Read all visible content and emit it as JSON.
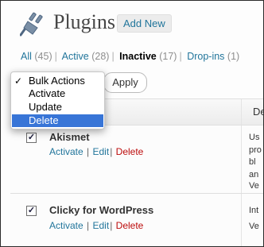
{
  "header": {
    "title": "Plugins",
    "add_new_label": "Add New",
    "icon": "plugin-plug-icon"
  },
  "filters": [
    {
      "label": "All",
      "count": "(45)",
      "current": false
    },
    {
      "label": "Active",
      "count": "(28)",
      "current": false
    },
    {
      "label": "Inactive",
      "count": "(17)",
      "current": true
    },
    {
      "label": "Drop-ins",
      "count": "(1)",
      "current": false
    }
  ],
  "bulk_actions": {
    "options": [
      "Bulk Actions",
      "Activate",
      "Update",
      "Delete"
    ],
    "checked_option": "Bulk Actions",
    "highlighted_option": "Delete"
  },
  "apply_label": "Apply",
  "table": {
    "desc_header": "De",
    "rows": [
      {
        "name": "Akismet",
        "checked": true,
        "actions": {
          "activate": "Activate",
          "edit": "Edit",
          "delete": "Delete",
          "separator": "|"
        },
        "description_fragments": [
          "Us",
          "pro",
          "bl",
          "an",
          "Ve"
        ]
      },
      {
        "name": "Clicky for WordPress",
        "checked": true,
        "actions": {
          "activate": "Activate",
          "edit": "Edit",
          "delete": "Delete",
          "separator": "|"
        },
        "description_fragments": [
          "Int",
          "Ve"
        ]
      }
    ]
  },
  "colors": {
    "link": "#21759b",
    "delete": "#bc0b0b",
    "highlight": "#3875d7"
  }
}
